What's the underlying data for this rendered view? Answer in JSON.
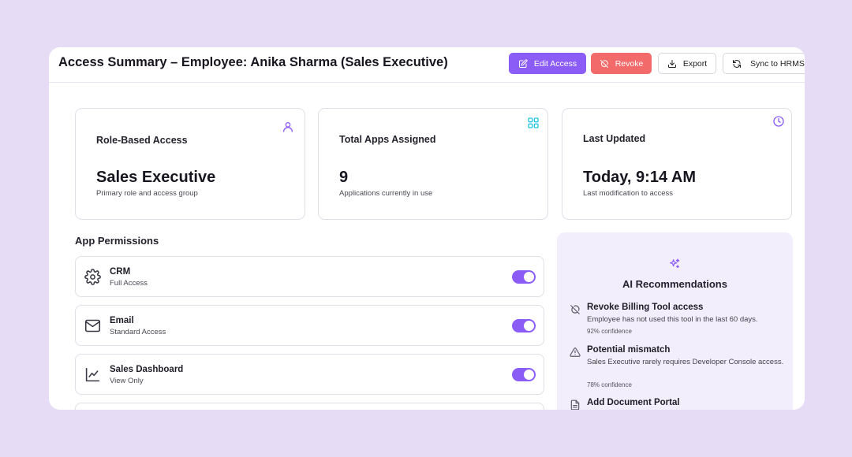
{
  "header": {
    "title": "Access Summary – Employee: Anika Sharma (Sales Executive)",
    "actions": {
      "edit_label": "Edit Access",
      "revoke_label": "Revoke",
      "export_label": "Export",
      "sync_label": "Sync to HRMS"
    }
  },
  "cards": [
    {
      "label": "Role-Based Access",
      "value": "Sales Executive",
      "sub": "Primary role and access group",
      "icon": "user-icon"
    },
    {
      "label": "Total Apps Assigned",
      "value": "9",
      "sub": "Applications currently in use",
      "icon": "apps-grid-icon"
    },
    {
      "label": "Last Updated",
      "value": "Today, 9:14 AM",
      "sub": "Last modification to access",
      "icon": "clock-icon"
    }
  ],
  "permissions": {
    "title": "App Permissions",
    "items": [
      {
        "name": "CRM",
        "level": "Full Access",
        "icon": "gear-icon",
        "enabled": true
      },
      {
        "name": "Email",
        "level": "Standard Access",
        "icon": "mail-icon",
        "enabled": true
      },
      {
        "name": "Sales Dashboard",
        "level": "View Only",
        "icon": "chart-line-icon",
        "enabled": true
      }
    ]
  },
  "ai": {
    "title": "AI Recommendations",
    "recommendations": [
      {
        "title": "Revoke Billing Tool access",
        "desc": "Employee has not used this tool in the last 60 days.",
        "confidence": "92% confidence",
        "icon": "no-access-icon"
      },
      {
        "title": "Potential mismatch",
        "desc": "Sales Executive rarely requires Developer Console access.",
        "confidence": "78% confidence",
        "icon": "warning-icon"
      },
      {
        "title": "Add Document Portal",
        "icon": "document-icon"
      }
    ]
  },
  "colors": {
    "accent": "#8b5cf6",
    "danger": "#f26a6a",
    "background": "#e7dcf6",
    "panel": "#f2eefc"
  }
}
